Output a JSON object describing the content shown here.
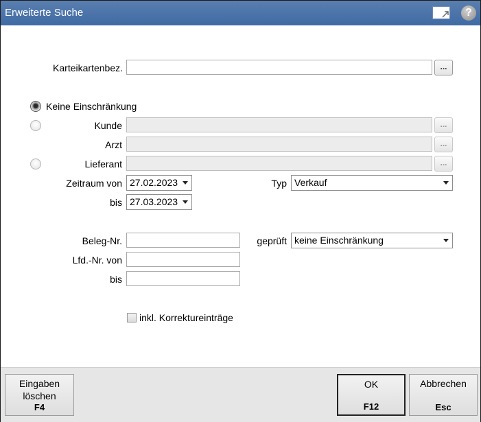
{
  "window": {
    "title": "Erweiterte Suche"
  },
  "form": {
    "karteikarte_label": "Karteikartenbez.",
    "karteikarte_value": "",
    "browse_label": "...",
    "radio_none_label": "Keine Einschränkung",
    "kunde_label": "Kunde",
    "arzt_label": "Arzt",
    "lieferant_label": "Lieferant",
    "zeitraum_label": "Zeitraum von",
    "date_from": "27.02.2023",
    "bis_label": "bis",
    "date_to": "27.03.2023",
    "typ_label": "Typ",
    "typ_value": "Verkauf",
    "beleg_label": "Beleg-Nr.",
    "geprueft_label": "geprüft",
    "geprueft_value": "keine Einschränkung",
    "lfd_label": "Lfd.-Nr. von",
    "lfd_bis_label": "bis",
    "korrektur_label": "inkl. Korrektureinträge",
    "korrektur_checked": false,
    "selected_radio": "keine"
  },
  "footer": {
    "clear_line1": "Eingaben",
    "clear_line2": "löschen",
    "clear_key": "F4",
    "ok_label": "OK",
    "ok_key": "F12",
    "cancel_label": "Abbrechen",
    "cancel_key": "Esc"
  },
  "colors": {
    "titlebar": "#4a73aa",
    "footer": "#e6e6e6"
  }
}
